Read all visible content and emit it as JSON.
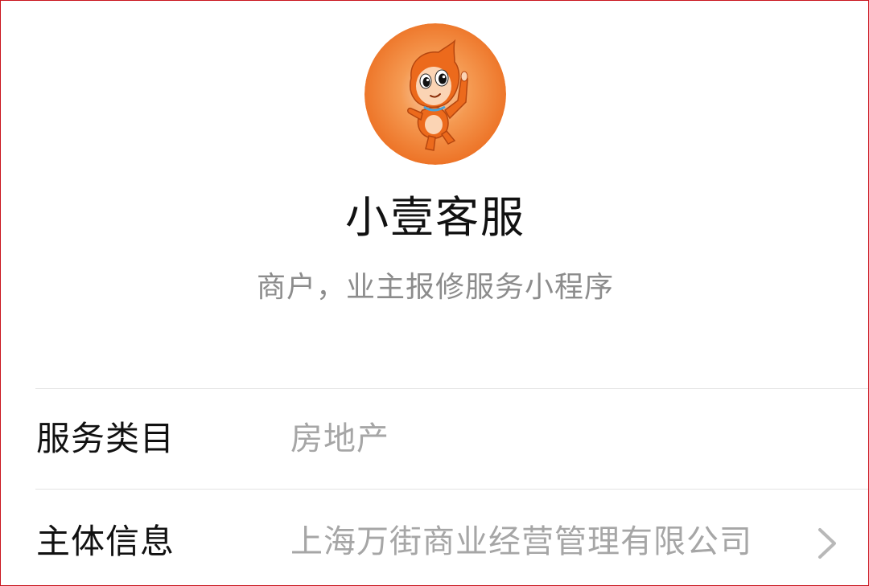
{
  "profile": {
    "avatar_icon": "orange-mascot-avatar-icon",
    "name": "小壹客服",
    "description": "商户，业主报修服务小程序",
    "avatar_color": "#f07424"
  },
  "info_rows": [
    {
      "label": "服务类目",
      "value": "房地产"
    },
    {
      "label": "主体信息",
      "value": "上海万街商业经营管理有限公司",
      "icon": "chevron-right-icon"
    }
  ],
  "colors": {
    "title": "#111111",
    "secondary_text": "#a6a6a6",
    "divider": "#e3e3e3",
    "frame_border": "#c9141e"
  }
}
